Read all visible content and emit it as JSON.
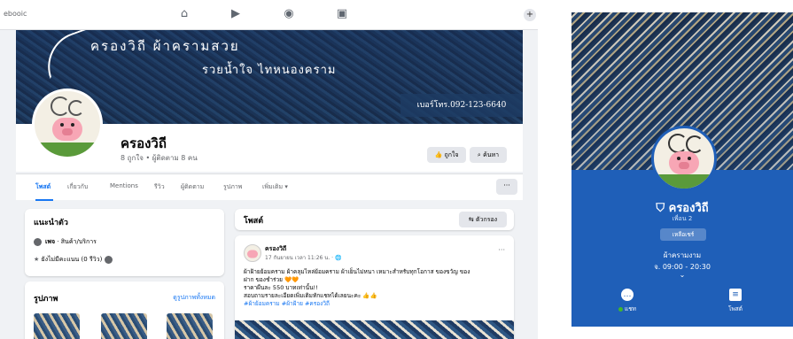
{
  "browser": {
    "tab_fragment": "ebooic",
    "new_tab_symbol": "+"
  },
  "nav": {
    "home_icon": "home-icon",
    "video_icon": "video-icon",
    "groups_icon": "groups-icon",
    "pages_icon": "pages-icon"
  },
  "cover": {
    "line1": "ครองวิถี  ผ้าครามสวย",
    "line2": "รวยน้ำใจ  ไทหนองคราม",
    "phone": "เบอร์โทร.092-123-6640"
  },
  "page": {
    "name": "ครองวิถี",
    "stats": "8 ถูกใจ • ผู้ติดตาม 8 คน",
    "like_button": "ถูกใจ",
    "search_button": "ค้นหา"
  },
  "tabs": [
    "โพสต์",
    "เกี่ยวกับ",
    "Mentions",
    "รีวิว",
    "ผู้ติดตาม",
    "รูปภาพ",
    "เพิ่มเติม ▾"
  ],
  "tabs_more": "···",
  "intro": {
    "title": "แนะนำตัว",
    "category_bold": "เพจ",
    "category_rest": " · สินค้า/บริการ",
    "rating": "ยังไม่มีคะแนน (0 รีวิว)"
  },
  "photos": {
    "title": "รูปภาพ",
    "see_all": "ดูรูปภาพทั้งหมด"
  },
  "posts": {
    "title": "โพสต์",
    "filter_button": "ตัวกรอง",
    "author": "ครองวิถี",
    "time": "17 กันยายน เวลา 11:26 น. · 🌐",
    "more": "···",
    "lines": [
      "ผ้าฝ้ายย้อมคราม ผ้าคลุมไหล่ย้อมคราม ผ้าเย็นไม่หนา เหมาะสำหรับทุกโอกาส ของขวัญ ของ",
      "ฝาก ของชำร่วย 🧡🧡",
      "ราคาผืนละ 550 บาทเท่านั้น!!",
      "สอบถามรายละเอียดเพิ่มเติมทักแชทได้เลยนะคะ 👍👍",
      "#ผ้าย้อมคราม #ผ้าฝ้าย #ครองวิถี"
    ]
  },
  "mobile": {
    "name": "ครองวิถี",
    "sub": "เพื่อน 2",
    "badge": "เหลือเชร์",
    "category": "ผ้าครามงาม",
    "hours": "จ. 09:00 - 20:30",
    "chevron": "⌄",
    "chat_label": "แชท",
    "posts_label": "โพสต์"
  },
  "colors": {
    "fb_blue": "#1877f2",
    "mobile_bg": "#1f5fb8",
    "page_bg": "#f0f2f5"
  }
}
